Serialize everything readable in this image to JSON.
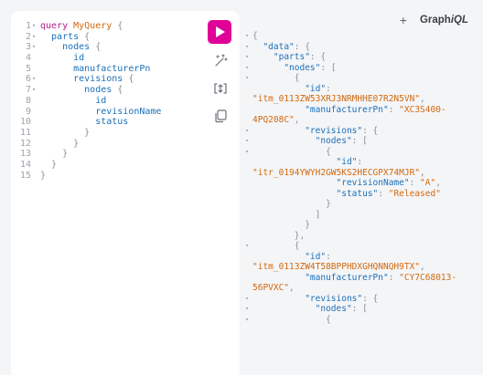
{
  "header": {
    "brand_prefix": "Graph",
    "brand_suffix": "iQL",
    "add_tab": "+"
  },
  "editor": {
    "fold_glyph": "▾",
    "lines": [
      {
        "n": "1",
        "fold": true,
        "tokens": [
          {
            "c": "kw",
            "t": "query "
          },
          {
            "c": "def",
            "t": "MyQuery"
          },
          {
            "c": "pn",
            "t": " {"
          }
        ]
      },
      {
        "n": "2",
        "fold": true,
        "tokens": [
          {
            "c": "fld",
            "t": "  parts"
          },
          {
            "c": "pn",
            "t": " {"
          }
        ]
      },
      {
        "n": "3",
        "fold": true,
        "tokens": [
          {
            "c": "fld",
            "t": "    nodes"
          },
          {
            "c": "pn",
            "t": " {"
          }
        ]
      },
      {
        "n": "4",
        "fold": false,
        "tokens": [
          {
            "c": "fld",
            "t": "      id"
          }
        ]
      },
      {
        "n": "5",
        "fold": false,
        "tokens": [
          {
            "c": "fld",
            "t": "      manufacturerPn"
          }
        ]
      },
      {
        "n": "6",
        "fold": true,
        "tokens": [
          {
            "c": "fld",
            "t": "      revisions"
          },
          {
            "c": "pn",
            "t": " {"
          }
        ]
      },
      {
        "n": "7",
        "fold": true,
        "tokens": [
          {
            "c": "fld",
            "t": "        nodes"
          },
          {
            "c": "pn",
            "t": " {"
          }
        ]
      },
      {
        "n": "8",
        "fold": false,
        "tokens": [
          {
            "c": "fld",
            "t": "          id"
          }
        ]
      },
      {
        "n": "9",
        "fold": false,
        "tokens": [
          {
            "c": "fld",
            "t": "          revisionName"
          }
        ]
      },
      {
        "n": "10",
        "fold": false,
        "tokens": [
          {
            "c": "fld",
            "t": "          status"
          }
        ]
      },
      {
        "n": "11",
        "fold": false,
        "tokens": [
          {
            "c": "pn",
            "t": "        }"
          }
        ]
      },
      {
        "n": "12",
        "fold": false,
        "tokens": [
          {
            "c": "pn",
            "t": "      }"
          }
        ]
      },
      {
        "n": "13",
        "fold": false,
        "tokens": [
          {
            "c": "pn",
            "t": "    }"
          }
        ]
      },
      {
        "n": "14",
        "fold": false,
        "tokens": [
          {
            "c": "pn",
            "t": "  }"
          }
        ]
      },
      {
        "n": "15",
        "fold": false,
        "tokens": [
          {
            "c": "pn",
            "t": "}"
          }
        ]
      }
    ]
  },
  "result": {
    "fold_glyph": "▾",
    "lines": [
      {
        "fold": true,
        "tokens": [
          {
            "c": "jp",
            "t": "{"
          }
        ]
      },
      {
        "fold": true,
        "tokens": [
          {
            "c": "jk",
            "t": "  \"data\""
          },
          {
            "c": "jp",
            "t": ": {"
          }
        ]
      },
      {
        "fold": true,
        "tokens": [
          {
            "c": "jk",
            "t": "    \"parts\""
          },
          {
            "c": "jp",
            "t": ": {"
          }
        ]
      },
      {
        "fold": true,
        "tokens": [
          {
            "c": "jk",
            "t": "      \"nodes\""
          },
          {
            "c": "jp",
            "t": ": ["
          }
        ]
      },
      {
        "fold": true,
        "tokens": [
          {
            "c": "jp",
            "t": "        {"
          }
        ]
      },
      {
        "fold": false,
        "tokens": [
          {
            "c": "jk",
            "t": "          \"id\""
          },
          {
            "c": "jp",
            "t": ":"
          }
        ]
      },
      {
        "fold": false,
        "tokens": [
          {
            "c": "js",
            "t": "\"itm_0113ZW53XRJ3NRMHHE07R2N5VN\""
          },
          {
            "c": "jp",
            "t": ","
          }
        ]
      },
      {
        "fold": false,
        "tokens": [
          {
            "c": "jk",
            "t": "          \"manufacturerPn\""
          },
          {
            "c": "jp",
            "t": ": "
          },
          {
            "c": "js",
            "t": "\"XC3S400-"
          }
        ]
      },
      {
        "fold": false,
        "tokens": [
          {
            "c": "js",
            "t": "4PQ208C\""
          },
          {
            "c": "jp",
            "t": ","
          }
        ]
      },
      {
        "fold": true,
        "tokens": [
          {
            "c": "jk",
            "t": "          \"revisions\""
          },
          {
            "c": "jp",
            "t": ": {"
          }
        ]
      },
      {
        "fold": true,
        "tokens": [
          {
            "c": "jk",
            "t": "            \"nodes\""
          },
          {
            "c": "jp",
            "t": ": ["
          }
        ]
      },
      {
        "fold": true,
        "tokens": [
          {
            "c": "jp",
            "t": "              {"
          }
        ]
      },
      {
        "fold": false,
        "tokens": [
          {
            "c": "jk",
            "t": "                \"id\""
          },
          {
            "c": "jp",
            "t": ":"
          }
        ]
      },
      {
        "fold": false,
        "tokens": [
          {
            "c": "js",
            "t": "\"itr_0194YWYH2GW5KS2HECGPX74MJR\""
          },
          {
            "c": "jp",
            "t": ","
          }
        ]
      },
      {
        "fold": false,
        "tokens": [
          {
            "c": "jk",
            "t": "                \"revisionName\""
          },
          {
            "c": "jp",
            "t": ": "
          },
          {
            "c": "js",
            "t": "\"A\""
          },
          {
            "c": "jp",
            "t": ","
          }
        ]
      },
      {
        "fold": false,
        "tokens": [
          {
            "c": "jk",
            "t": "                \"status\""
          },
          {
            "c": "jp",
            "t": ": "
          },
          {
            "c": "js",
            "t": "\"Released\""
          }
        ]
      },
      {
        "fold": false,
        "tokens": [
          {
            "c": "jp",
            "t": "              }"
          }
        ]
      },
      {
        "fold": false,
        "tokens": [
          {
            "c": "jp",
            "t": "            ]"
          }
        ]
      },
      {
        "fold": false,
        "tokens": [
          {
            "c": "jp",
            "t": "          }"
          }
        ]
      },
      {
        "fold": false,
        "tokens": [
          {
            "c": "jp",
            "t": "        },"
          }
        ]
      },
      {
        "fold": true,
        "tokens": [
          {
            "c": "jp",
            "t": "        {"
          }
        ]
      },
      {
        "fold": false,
        "tokens": [
          {
            "c": "jk",
            "t": "          \"id\""
          },
          {
            "c": "jp",
            "t": ":"
          }
        ]
      },
      {
        "fold": false,
        "tokens": [
          {
            "c": "js",
            "t": "\"itm_0113ZW4T58BPPHDXGHQNNQH9TX\""
          },
          {
            "c": "jp",
            "t": ","
          }
        ]
      },
      {
        "fold": false,
        "tokens": [
          {
            "c": "jk",
            "t": "          \"manufacturerPn\""
          },
          {
            "c": "jp",
            "t": ": "
          },
          {
            "c": "js",
            "t": "\"CY7C68013-"
          }
        ]
      },
      {
        "fold": false,
        "tokens": [
          {
            "c": "js",
            "t": "56PVXC\""
          },
          {
            "c": "jp",
            "t": ","
          }
        ]
      },
      {
        "fold": true,
        "tokens": [
          {
            "c": "jk",
            "t": "          \"revisions\""
          },
          {
            "c": "jp",
            "t": ": {"
          }
        ]
      },
      {
        "fold": true,
        "tokens": [
          {
            "c": "jk",
            "t": "            \"nodes\""
          },
          {
            "c": "jp",
            "t": ": ["
          }
        ]
      },
      {
        "fold": true,
        "tokens": [
          {
            "c": "jp",
            "t": "              {"
          }
        ]
      }
    ]
  },
  "toolbar": {
    "run_icon": "play-icon",
    "prettify_icon": "magic-wand-icon",
    "merge_icon": "merge-fragments-icon",
    "copy_icon": "copy-icon"
  },
  "colors": {
    "run_button": "#e10098",
    "keyword": "#b01c8c",
    "definition": "#d2690e",
    "field": "#1b6fb8",
    "string": "#d2690e"
  }
}
